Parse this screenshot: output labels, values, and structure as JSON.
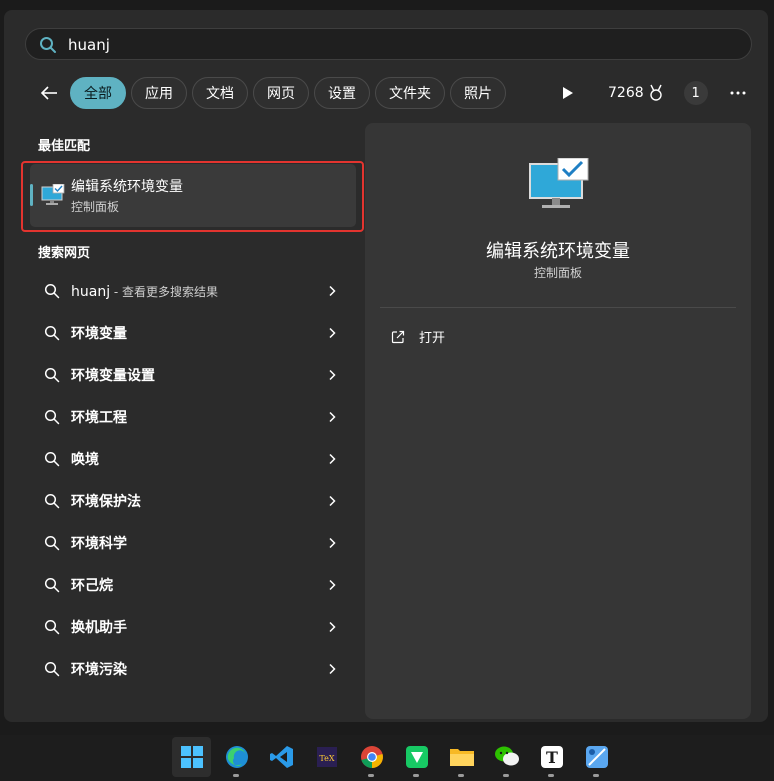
{
  "search": {
    "query": "huanj",
    "placeholder": ""
  },
  "tabs": [
    {
      "label": "全部",
      "active": true
    },
    {
      "label": "应用"
    },
    {
      "label": "文档"
    },
    {
      "label": "网页"
    },
    {
      "label": "设置"
    },
    {
      "label": "文件夹"
    },
    {
      "label": "照片"
    }
  ],
  "header": {
    "points": "7268",
    "notification_count": "1"
  },
  "best_match": {
    "section_title": "最佳匹配",
    "title": "编辑系统环境变量",
    "subtitle": "控制面板"
  },
  "web_search": {
    "section_title": "搜索网页",
    "items": [
      {
        "label": "huanj",
        "suffix": " - 查看更多搜索结果"
      },
      {
        "label": "环境变量"
      },
      {
        "label": "环境变量设置"
      },
      {
        "label": "环境工程"
      },
      {
        "label": "唤境"
      },
      {
        "label": "环境保护法"
      },
      {
        "label": "环境科学"
      },
      {
        "label": "环己烷"
      },
      {
        "label": "换机助手"
      },
      {
        "label": "环境污染"
      }
    ]
  },
  "preview": {
    "title": "编辑系统环境变量",
    "subtitle": "控制面板",
    "action_open": "打开"
  },
  "taskbar": {
    "apps": [
      "start-icon",
      "edge-icon",
      "vscode-icon",
      "texmaker-icon",
      "chrome-icon",
      "toolbox-icon",
      "file-explorer-icon",
      "wechat-icon",
      "typora-icon",
      "snipping-icon"
    ]
  },
  "colors": {
    "accent": "#5fb2c2",
    "highlight": "#e3342f"
  }
}
